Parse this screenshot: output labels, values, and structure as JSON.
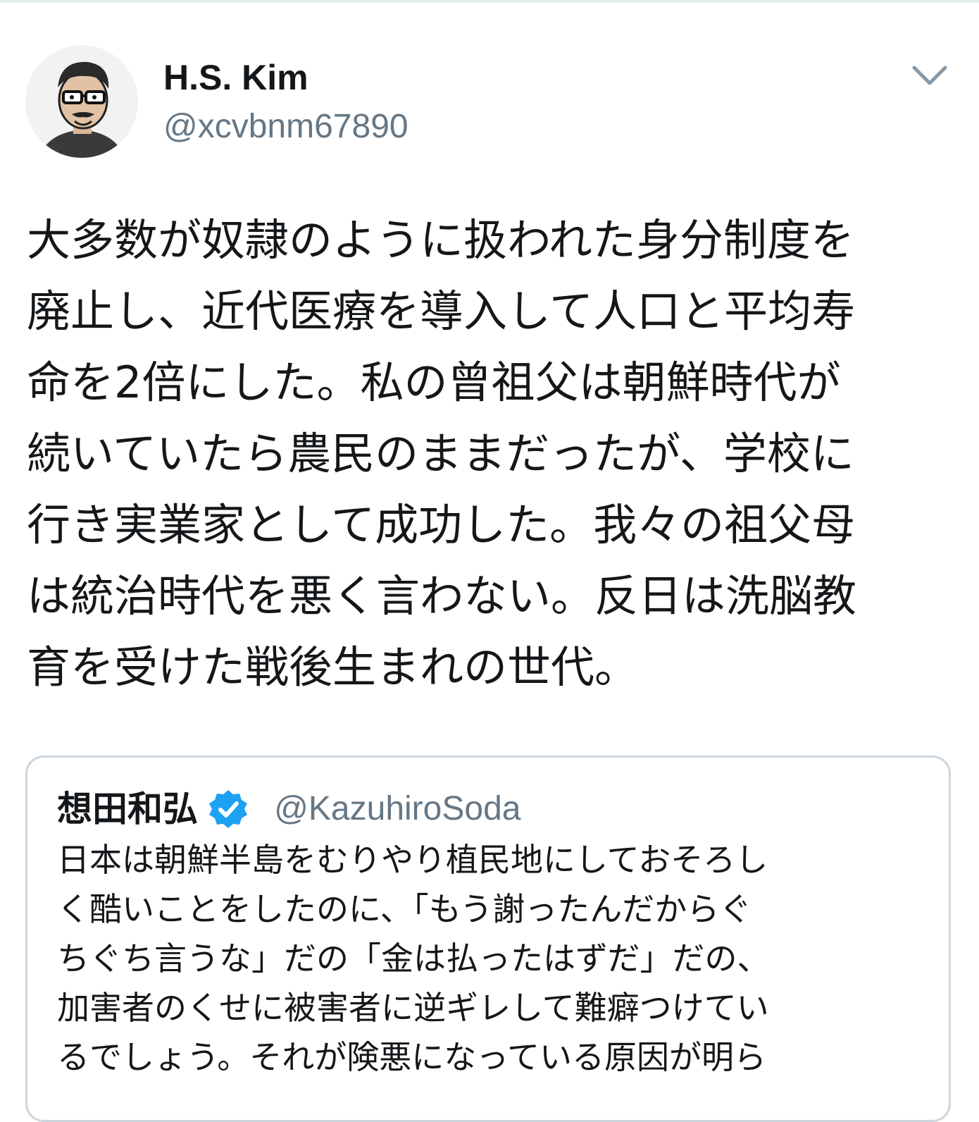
{
  "tweet": {
    "author": {
      "display_name": "H.S. Kim",
      "handle": "@xcvbnm67890",
      "avatar_icon": "cartoon-portrait-avatar"
    },
    "menu_icon": "chevron-down-icon",
    "text_lines": [
      "大多数が奴隷のように扱われた身分制度を",
      "廃止し、近代医療を導入して人口と平均寿",
      "命を2倍にした。私の曾祖父は朝鮮時代が",
      "続いていたら農民のままだったが、学校に",
      "行き実業家として成功した。我々の祖父母",
      "は統治時代を悪く言わない。反日は洗脳教",
      "育を受けた戦後生まれの世代。"
    ]
  },
  "quoted_tweet": {
    "display_name": "想田和弘",
    "verified_icon": "verified-badge-icon",
    "handle": "@KazuhiroSoda",
    "text_lines": [
      "日本は朝鮮半島をむりやり植民地にしておそろし",
      "く酷いことをしたのに、「もう謝ったんだからぐ",
      "ちぐち言うな」だの「金は払ったはずだ」だの、",
      "加害者のくせに被害者に逆ギレして難癖つけてい",
      "るでしょう。それが険悪になっている原因が明ら"
    ]
  },
  "colors": {
    "text_primary": "#14171a",
    "text_secondary": "#657786",
    "verified_blue": "#1da1f2",
    "card_border": "#ccd6dd"
  }
}
